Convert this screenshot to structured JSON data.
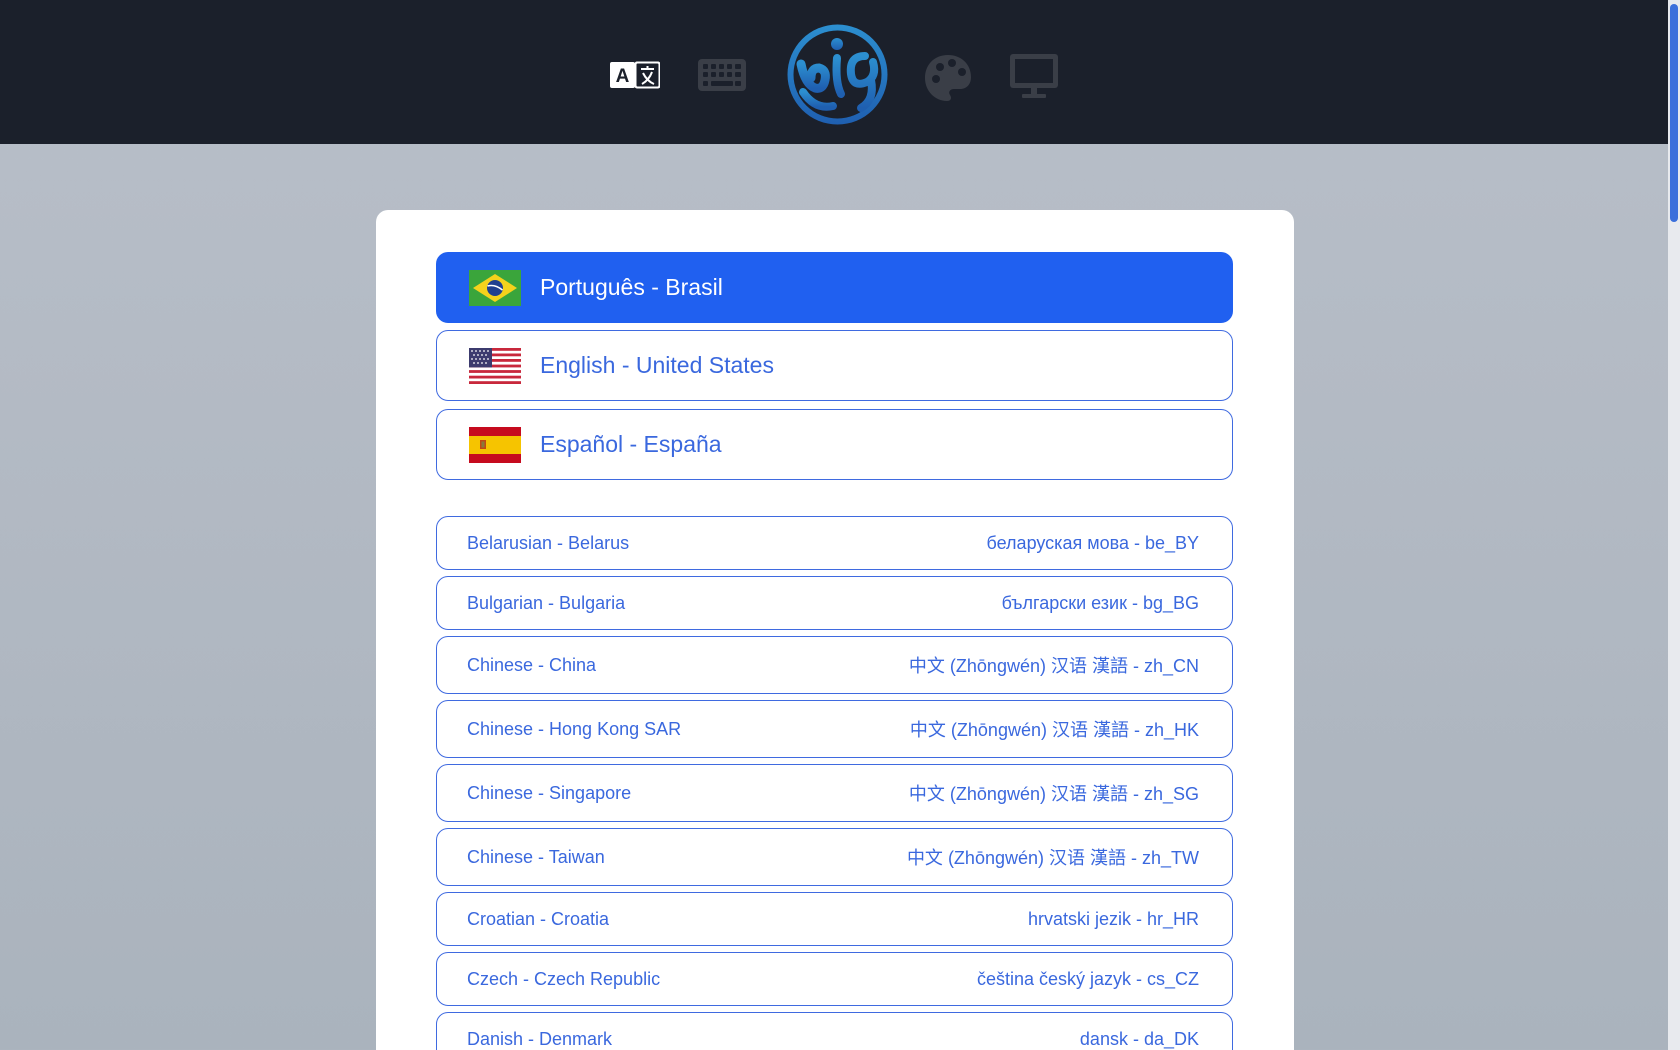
{
  "header": {
    "icons": [
      "translate-icon",
      "keyboard-icon",
      "app-logo",
      "palette-icon",
      "monitor-icon"
    ]
  },
  "featured_languages": [
    {
      "label": "Português - Brasil",
      "flag": "brazil",
      "selected": true
    },
    {
      "label": "English - United States",
      "flag": "united-states",
      "selected": false
    },
    {
      "label": "Español - España",
      "flag": "spain",
      "selected": false
    }
  ],
  "languages": [
    {
      "name": "Belarusian - Belarus",
      "native": "беларуская мова - be_BY"
    },
    {
      "name": "Bulgarian - Bulgaria",
      "native": "български език - bg_BG"
    },
    {
      "name": "Chinese - China",
      "native": "中文 (Zhōngwén) 汉语 漢語 - zh_CN"
    },
    {
      "name": "Chinese - Hong Kong SAR",
      "native": "中文 (Zhōngwén) 汉语 漢語 - zh_HK"
    },
    {
      "name": "Chinese - Singapore",
      "native": "中文 (Zhōngwén) 汉语 漢語 - zh_SG"
    },
    {
      "name": "Chinese - Taiwan",
      "native": "中文 (Zhōngwén) 汉语 漢語 - zh_TW"
    },
    {
      "name": "Croatian - Croatia",
      "native": "hrvatski jezik - hr_HR"
    },
    {
      "name": "Czech - Czech Republic",
      "native": "čeština český jazyk - cs_CZ"
    },
    {
      "name": "Danish - Denmark",
      "native": "dansk - da_DK"
    }
  ],
  "colors": {
    "header_bg": "#1b202b",
    "accent": "#2060f0",
    "text_accent": "#3a68de",
    "logo_gradient_top": "#2c8fd0",
    "logo_gradient_bottom": "#1f5fb0"
  }
}
